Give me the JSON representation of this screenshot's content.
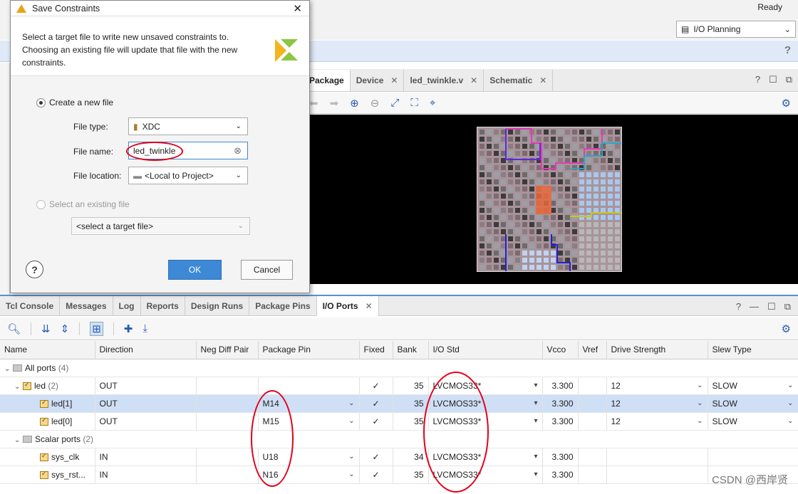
{
  "app": {
    "status": "Ready",
    "layout_select": "I/O Planning",
    "colors": {
      "accent": "#3d89d6",
      "selection": "#cfdff5",
      "annotation": "#e0001a"
    }
  },
  "device_tabs": [
    {
      "label": "Package",
      "active": true
    },
    {
      "label": "Device",
      "active": false
    },
    {
      "label": "led_twinkle.v",
      "active": false
    },
    {
      "label": "Schematic",
      "active": false
    }
  ],
  "bottom_tabs": [
    {
      "label": "Tcl Console",
      "active": false
    },
    {
      "label": "Messages",
      "active": false
    },
    {
      "label": "Log",
      "active": false
    },
    {
      "label": "Reports",
      "active": false
    },
    {
      "label": "Design Runs",
      "active": false
    },
    {
      "label": "Package Pins",
      "active": false
    },
    {
      "label": "I/O Ports",
      "active": true
    }
  ],
  "ports_table": {
    "columns": [
      "Name",
      "Direction",
      "Neg Diff Pair",
      "Package Pin",
      "Fixed",
      "Bank",
      "I/O Std",
      "Vcco",
      "Vref",
      "Drive Strength",
      "Slew Type"
    ],
    "groups": {
      "all_ports": {
        "label": "All ports",
        "count": "(4)"
      },
      "led": {
        "label": "led",
        "count": "(2)",
        "direction": "OUT",
        "fixed": "✓",
        "bank": "35",
        "iostd": "LVCMOS33*",
        "vcco": "3.300",
        "drive": "12",
        "slew": "SLOW"
      },
      "scalar": {
        "label": "Scalar ports",
        "count": "(2)"
      }
    },
    "rows": [
      {
        "name": "led[1]",
        "direction": "OUT",
        "pin": "M14",
        "fixed": "✓",
        "bank": "35",
        "iostd": "LVCMOS33*",
        "vcco": "3.300",
        "drive": "12",
        "slew": "SLOW"
      },
      {
        "name": "led[0]",
        "direction": "OUT",
        "pin": "M15",
        "fixed": "✓",
        "bank": "35",
        "iostd": "LVCMOS33*",
        "vcco": "3.300",
        "drive": "12",
        "slew": "SLOW"
      },
      {
        "name": "sys_clk",
        "direction": "IN",
        "pin": "U18",
        "fixed": "✓",
        "bank": "34",
        "iostd": "LVCMOS33*",
        "vcco": "3.300",
        "drive": "",
        "slew": ""
      },
      {
        "name": "sys_rst...",
        "direction": "IN",
        "pin": "N16",
        "fixed": "✓",
        "bank": "35",
        "iostd": "LVCMOS33*",
        "vcco": "3.300",
        "drive": "",
        "slew": ""
      }
    ]
  },
  "dialog": {
    "title": "Save Constraints",
    "description": "Select a target file to write new unsaved constraints to. Choosing an existing file will update that file with the new constraints.",
    "create_new_label": "Create a new file",
    "file_type_label": "File type:",
    "file_type_value": "XDC",
    "file_name_label": "File name:",
    "file_name_value": "led_twinkle",
    "file_location_label": "File location:",
    "file_location_value": "<Local to Project>",
    "select_existing_label": "Select an existing file",
    "target_file_placeholder": "<select a target file>",
    "ok_label": "OK",
    "cancel_label": "Cancel",
    "help_label": "?"
  },
  "watermark": "CSDN @西岸贤"
}
